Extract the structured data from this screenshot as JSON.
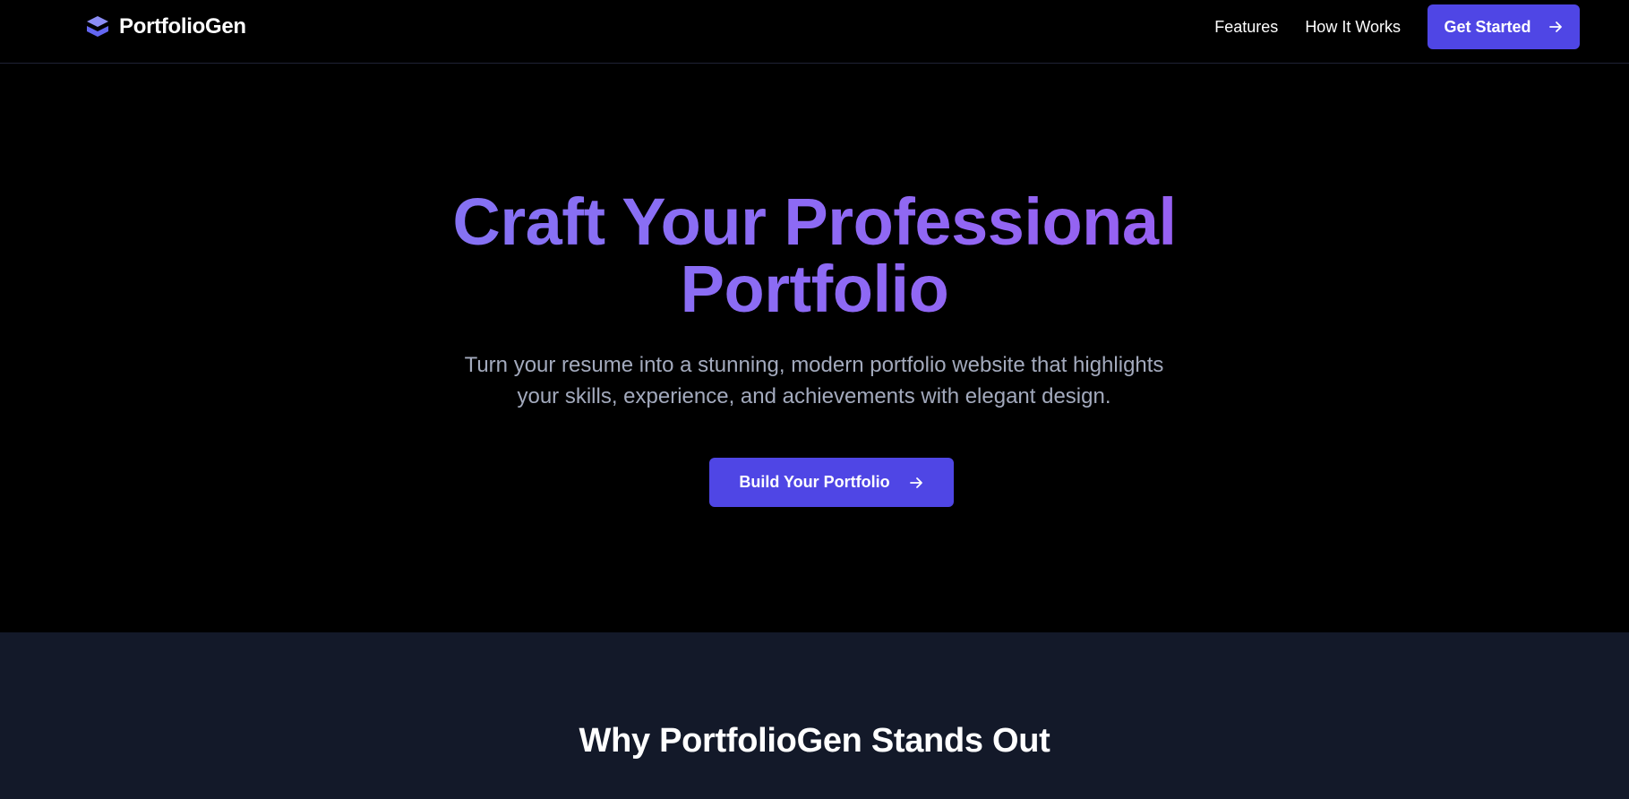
{
  "nav": {
    "brand": "PortfolioGen",
    "brand_icon": "stacked-layers-icon",
    "links": [
      "Features",
      "How It Works"
    ],
    "cta_label": "Get Started",
    "cta_icon": "arrow-right-icon"
  },
  "hero": {
    "title_line1": "Craft Your Professional",
    "title_line2": "Portfolio",
    "subtitle": "Turn your resume into a stunning, modern portfolio website that highlights your skills, experience, and achievements with elegant design.",
    "cta_label": "Build Your Portfolio",
    "cta_icon": "arrow-right-icon"
  },
  "features": {
    "title": "Why PortfolioGen Stands Out"
  },
  "colors": {
    "accent": "#4f46e5",
    "gradient_start": "#7c7bf2",
    "gradient_end": "#a355f0",
    "page_background": "#000000",
    "section_background": "#131929",
    "subtitle_text": "#a3aabd"
  }
}
